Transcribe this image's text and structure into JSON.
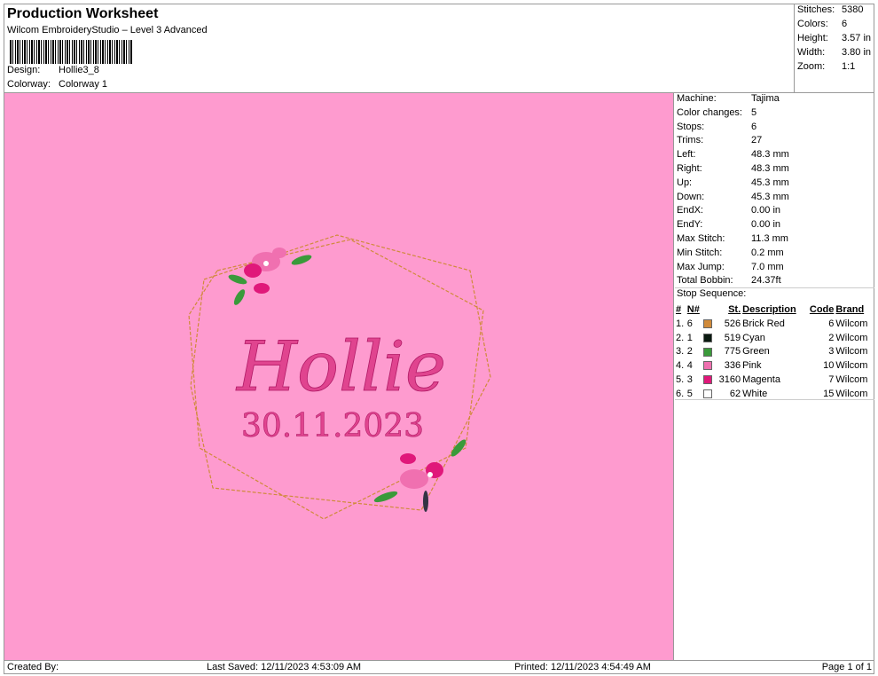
{
  "header": {
    "title": "Production Worksheet",
    "subtitle": "Wilcom EmbroideryStudio – Level 3 Advanced",
    "design_label": "Design:",
    "design": "Hollie3_8",
    "colorway_label": "Colorway:",
    "colorway": "Colorway 1"
  },
  "summary": [
    {
      "l": "Stitches:",
      "v": "5380"
    },
    {
      "l": "Colors:",
      "v": "6"
    },
    {
      "l": "Height:",
      "v": "3.57 in"
    },
    {
      "l": "Width:",
      "v": "3.80 in"
    },
    {
      "l": "Zoom:",
      "v": "1:1"
    }
  ],
  "info": [
    {
      "l": "Machine:",
      "v": "Tajima"
    },
    {
      "l": "Color changes:",
      "v": "5"
    },
    {
      "l": "Stops:",
      "v": "6"
    },
    {
      "l": "Trims:",
      "v": "27"
    },
    {
      "l": "Left:",
      "v": "48.3 mm"
    },
    {
      "l": "Right:",
      "v": "48.3 mm"
    },
    {
      "l": "Up:",
      "v": "45.3 mm"
    },
    {
      "l": "Down:",
      "v": "45.3 mm"
    },
    {
      "l": "EndX:",
      "v": "0.00 in"
    },
    {
      "l": "EndY:",
      "v": "0.00 in"
    },
    {
      "l": "Max Stitch:",
      "v": "11.3 mm"
    },
    {
      "l": "Min Stitch:",
      "v": "0.2 mm"
    },
    {
      "l": "Max Jump:",
      "v": "7.0 mm"
    },
    {
      "l": "Total Bobbin:",
      "v": "24.37ft"
    }
  ],
  "stop_sequence": {
    "title": "Stop Sequence:",
    "headers": [
      "#",
      "N#",
      "St.",
      "Description",
      "Code",
      "Brand"
    ],
    "rows": [
      {
        "i": "1.",
        "n": "6",
        "color": "#d08a3a",
        "st": "526",
        "desc": "Brick Red",
        "code": "6",
        "brand": "Wilcom"
      },
      {
        "i": "2.",
        "n": "1",
        "color": "#0a1a10",
        "st": "519",
        "desc": "Cyan",
        "code": "2",
        "brand": "Wilcom"
      },
      {
        "i": "3.",
        "n": "2",
        "color": "#3a9a3a",
        "st": "775",
        "desc": "Green",
        "code": "3",
        "brand": "Wilcom"
      },
      {
        "i": "4.",
        "n": "4",
        "color": "#f070b0",
        "st": "336",
        "desc": "Pink",
        "code": "10",
        "brand": "Wilcom"
      },
      {
        "i": "5.",
        "n": "3",
        "color": "#e0187a",
        "st": "3160",
        "desc": "Magenta",
        "code": "7",
        "brand": "Wilcom"
      },
      {
        "i": "6.",
        "n": "5",
        "color": "#ffffff",
        "st": "62",
        "desc": "White",
        "code": "15",
        "brand": "Wilcom"
      }
    ]
  },
  "design": {
    "name_text": "Hollie",
    "date_text": "30.11.2023",
    "background": "#fe9bcf"
  },
  "footer": {
    "created": "Created By:",
    "saved": "Last Saved: 12/11/2023 4:53:09 AM",
    "printed": "Printed: 12/11/2023 4:54:49 AM",
    "page": "Page 1 of 1"
  }
}
